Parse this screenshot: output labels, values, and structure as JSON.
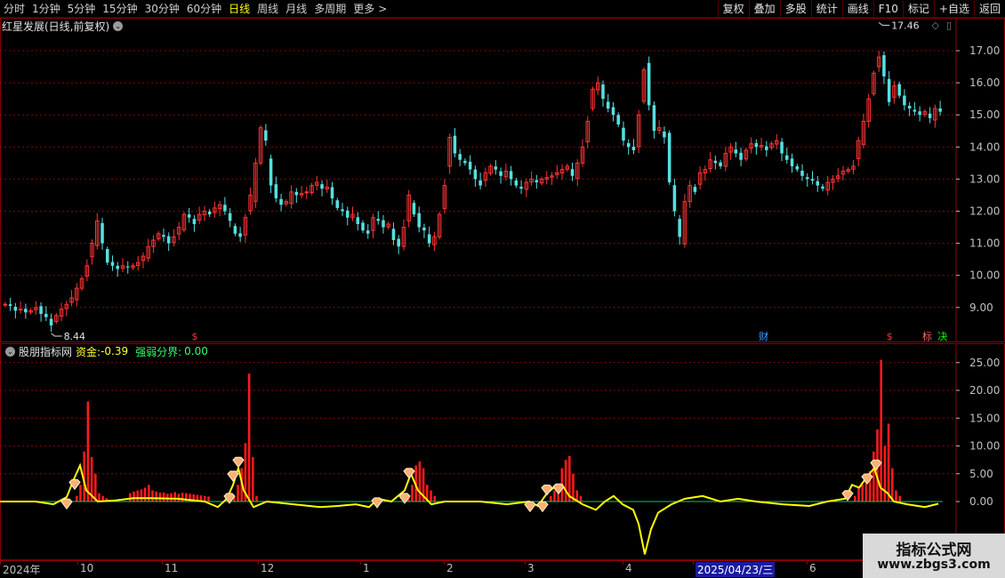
{
  "toolbar": {
    "periods": [
      "分时",
      "1分钟",
      "5分钟",
      "15分钟",
      "30分钟",
      "60分钟",
      "日线",
      "周线",
      "月线",
      "多周期",
      "更多"
    ],
    "active_period": "日线",
    "more_arrow": ">",
    "buttons": [
      "复权",
      "叠加",
      "多股",
      "统计",
      "画线",
      "F10",
      "标记",
      "+自选",
      "返回"
    ]
  },
  "main": {
    "stock_name": "红星发展(日线,前复权)",
    "high_label": "17.46",
    "low_label": "8.44",
    "price_ticks": [
      "17.00",
      "16.00",
      "15.00",
      "14.00",
      "13.00",
      "12.00",
      "11.00",
      "10.00",
      "9.00"
    ],
    "event_markers": [
      "$",
      "财",
      "$",
      "标",
      "决"
    ]
  },
  "indicator": {
    "name": "股朋指标网",
    "fund_label": "资金:",
    "fund_value": "-0.39",
    "divider_label": "强弱分界:",
    "divider_value": "0.00",
    "ticks": [
      "25.00",
      "20.00",
      "15.00",
      "10.00",
      "5.00",
      "0.00"
    ]
  },
  "xaxis": {
    "labels": [
      "2024年",
      "10",
      "11",
      "12",
      "1",
      "2",
      "3",
      "4",
      "2025/04/23/三",
      "6"
    ]
  },
  "watermark": {
    "title": "指标公式网",
    "url": "www.zbgs3.com"
  },
  "colors": {
    "up": "#ff3333",
    "down": "#55e0e0",
    "fund_line": "#ffff00",
    "divider_line": "#00cc66",
    "grid": "#8b0000"
  },
  "chart_data": [
    {
      "type": "candlestick",
      "title": "红星发展(日线,前复权)",
      "y_ticks": [
        9,
        10,
        11,
        12,
        13,
        14,
        15,
        16,
        17
      ],
      "ylim": [
        8.2,
        17.9
      ],
      "x_labels": [
        "2024年",
        "10",
        "11",
        "12",
        "1",
        "2",
        "3",
        "4",
        "2025/04/23/三",
        "6"
      ],
      "grid": true,
      "max_annotation": 17.46,
      "min_annotation": 8.44,
      "closes": [
        9.1,
        9.05,
        8.9,
        8.95,
        8.85,
        8.9,
        9.0,
        8.8,
        8.7,
        8.44,
        8.75,
        8.95,
        9.1,
        9.3,
        9.6,
        9.9,
        10.3,
        11.0,
        11.7,
        11.0,
        10.4,
        10.3,
        10.2,
        10.3,
        10.25,
        10.3,
        10.4,
        10.6,
        10.9,
        11.1,
        11.3,
        11.2,
        11.0,
        11.2,
        11.5,
        11.9,
        11.8,
        11.6,
        11.9,
        12.0,
        11.9,
        12.1,
        12.2,
        12.0,
        11.7,
        11.3,
        11.2,
        11.8,
        12.5,
        13.5,
        14.6,
        14.2,
        12.8,
        12.4,
        12.2,
        12.3,
        12.6,
        12.5,
        12.55,
        12.6,
        12.8,
        12.9,
        12.7,
        12.75,
        12.4,
        12.1,
        12.0,
        11.8,
        11.9,
        11.6,
        11.4,
        11.3,
        11.8,
        11.7,
        11.5,
        11.6,
        11.1,
        10.9,
        11.5,
        12.5,
        11.9,
        11.5,
        11.4,
        11.0,
        11.2,
        11.9,
        12.8,
        14.3,
        13.8,
        13.6,
        13.5,
        13.3,
        13.0,
        12.8,
        13.2,
        13.4,
        13.3,
        13.1,
        13.25,
        13.0,
        12.8,
        12.7,
        12.9,
        13.0,
        12.9,
        13.0,
        13.05,
        13.1,
        13.2,
        13.3,
        13.4,
        13.1,
        13.5,
        14.0,
        14.8,
        15.8,
        16.0,
        15.5,
        15.2,
        15.0,
        14.7,
        14.2,
        14.0,
        13.9,
        15.0,
        16.4,
        15.3,
        14.5,
        14.6,
        14.3,
        12.9,
        12.0,
        11.2,
        12.3,
        12.8,
        12.6,
        13.2,
        13.3,
        13.6,
        13.5,
        13.4,
        13.8,
        14.0,
        13.8,
        13.6,
        13.9,
        14.1,
        14.0,
        14.05,
        13.9,
        14.1,
        14.2,
        13.8,
        13.6,
        13.4,
        13.3,
        13.1,
        13.0,
        12.95,
        12.8,
        12.7,
        12.9,
        13.0,
        13.1,
        13.25,
        13.3,
        13.4,
        14.2,
        14.8,
        15.5,
        16.3,
        16.8,
        16.2,
        15.4,
        15.9,
        15.6,
        15.3,
        15.2,
        15.1,
        15.0,
        15.1,
        14.9,
        15.2,
        15.1
      ]
    },
    {
      "type": "bar+line",
      "title": "股朋指标网",
      "y_ticks": [
        0,
        5,
        10,
        15,
        20,
        25
      ],
      "ylim": [
        -10,
        26.5
      ],
      "series": [
        {
          "name": "资金",
          "last_value": -0.39
        },
        {
          "name": "强弱分界",
          "value": 0.0
        }
      ]
    }
  ]
}
